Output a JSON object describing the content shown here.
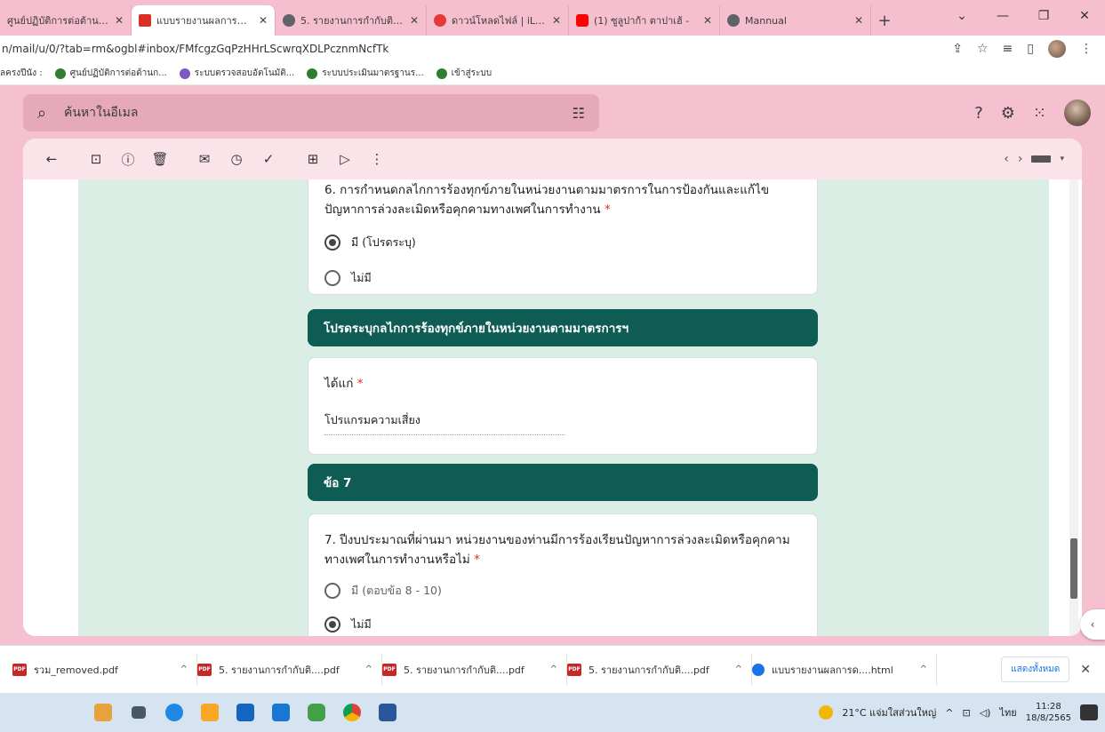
{
  "browser": {
    "tabs": [
      {
        "title": "ศูนย์ปฏิบัติการต่อต้านการท",
        "favicon_color": "#2e7d32",
        "active": false
      },
      {
        "title": "แบบรายงานผลการดำเนินก",
        "favicon_color": "#d93025",
        "active": true
      },
      {
        "title": "5. รายงานการกำกับติดตามฯ",
        "favicon_color": "#5f6368",
        "active": false
      },
      {
        "title": "ดาวน์โหลดไฟล์ | iLovePDF",
        "favicon_color": "#e53935",
        "active": false
      },
      {
        "title": "(1) ซูลูปาก้า ตาปาเฮ้ -",
        "favicon_color": "#ff0000",
        "active": false
      },
      {
        "title": "Mannual",
        "favicon_color": "#5f6368",
        "active": false
      }
    ],
    "new_tab_symbol": "+",
    "url": "n/mail/u/0/?tab=rm&ogbl#inbox/FMfcgzGqPzHHrLScwrqXDLPcznmNcfTk",
    "bookmarks": [
      {
        "label": "ลครงปีนัง :"
      },
      {
        "label": "ศูนย์ปฏิบัติการต่อต้านก..."
      },
      {
        "label": "ระบบตรวจสอบอัตโนมัติ..."
      },
      {
        "label": "ระบบประเมินมาตรฐานร..."
      },
      {
        "label": "เข้าสู่ระบบ"
      }
    ]
  },
  "gmail": {
    "search_placeholder": "ค้นหาในอีเมล"
  },
  "form": {
    "q6": {
      "text": "6. การกำหนดกลไกการร้องทุกข์ภายในหน่วยงานตามมาตรการในการป้องกันและแก้ไขปัญหาการล่วงละเมิดหรือคุกคามทางเพศในการทำงาน",
      "required_mark": "*",
      "options": [
        {
          "label": "มี (โปรดระบุ)",
          "selected": true
        },
        {
          "label": "ไม่มี",
          "selected": false
        }
      ]
    },
    "section1_title": "โปรดระบุกลไกการร้องทุกข์ภายในหน่วยงานตามมาตรการฯ",
    "answer_card": {
      "label": "ได้แก่",
      "required_mark": "*",
      "value": "โปรแกรมความเสี่ยง"
    },
    "section2_title": "ข้อ 7",
    "q7": {
      "text": "7. ปีงบประมาณที่ผ่านมา หน่วยงานของท่านมีการร้องเรียนปัญหาการล่วงละเมิดหรือคุกคามทางเพศในการทำงานหรือไม่",
      "required_mark": "*",
      "options": [
        {
          "label": "มี (ตอบข้อ 8 - 10)",
          "selected": false
        },
        {
          "label": "ไม่มี",
          "selected": true
        }
      ]
    }
  },
  "downloads": {
    "items": [
      {
        "name": "รวม_removed.pdf"
      },
      {
        "name": "5. รายงานการกำกับติ....pdf"
      },
      {
        "name": "5. รายงานการกำกับติ....pdf"
      },
      {
        "name": "5. รายงานการกำกับติ....pdf"
      },
      {
        "name": "แบบรายงานผลการด....html"
      }
    ],
    "show_all": "แสดงทั้งหมด"
  },
  "taskbar": {
    "weather": "21°C แจ่มใสส่วนใหญ่",
    "lang": "ไทย",
    "time": "11:28",
    "date": "18/8/2565"
  }
}
